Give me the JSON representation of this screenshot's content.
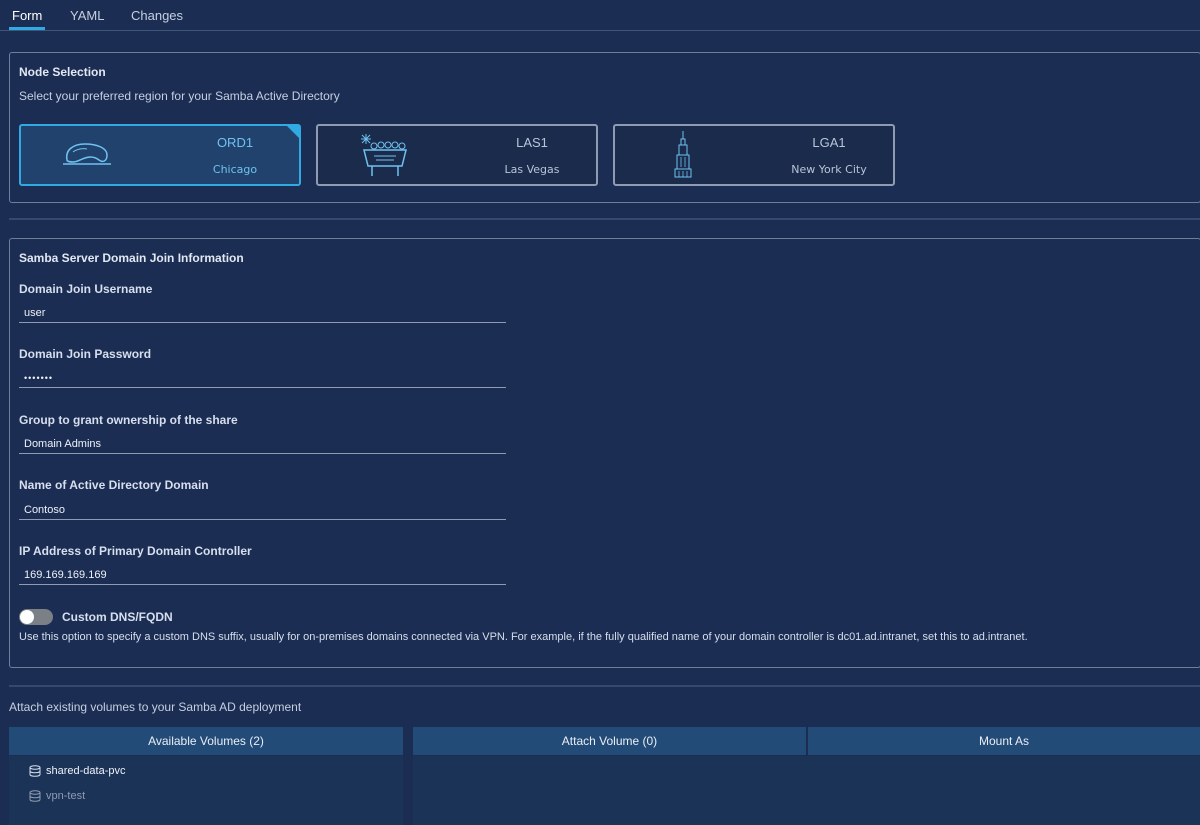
{
  "tabs": [
    {
      "label": "Form",
      "active": true
    },
    {
      "label": "YAML",
      "active": false
    },
    {
      "label": "Changes",
      "active": false
    }
  ],
  "node_selection": {
    "title": "Node Selection",
    "description": "Select your preferred region for your Samba Active Directory",
    "regions": [
      {
        "code": "ORD1",
        "city": "Chicago",
        "selected": true,
        "icon": "chicago-bean-icon"
      },
      {
        "code": "LAS1",
        "city": "Las Vegas",
        "selected": false,
        "icon": "las-vegas-sign-icon"
      },
      {
        "code": "LGA1",
        "city": "New York City",
        "selected": false,
        "icon": "empire-state-building-icon"
      }
    ]
  },
  "domain_join": {
    "title": "Samba Server Domain Join Information",
    "username_label": "Domain Join Username",
    "username_value": "user",
    "password_label": "Domain Join Password",
    "password_value": "•••••••",
    "group_label": "Group to grant ownership of the share",
    "group_value": "Domain Admins",
    "ad_domain_label": "Name of Active Directory Domain",
    "ad_domain_value": "Contoso",
    "dc_ip_label": "IP Address of Primary Domain Controller",
    "dc_ip_value": "169.169.169.169",
    "custom_dns_label": "Custom DNS/FQDN",
    "custom_dns_enabled": false,
    "custom_dns_help": "Use this option to specify a custom DNS suffix, usually for on-premises domains connected via VPN. For example, if the fully qualified name of your domain controller is dc01.ad.intranet, set this to ad.intranet."
  },
  "volumes": {
    "title": "Attach existing volumes to your Samba AD deployment",
    "available_header": "Available Volumes (2)",
    "attach_header": "Attach Volume (0)",
    "mount_header": "Mount As",
    "available": [
      {
        "name": "shared-data-pvc",
        "icon": "database-icon"
      },
      {
        "name": "vpn-test",
        "icon": "database-icon"
      }
    ]
  },
  "colors": {
    "background": "#1b2d52",
    "accent": "#31a9e3",
    "header": "#234b77"
  }
}
